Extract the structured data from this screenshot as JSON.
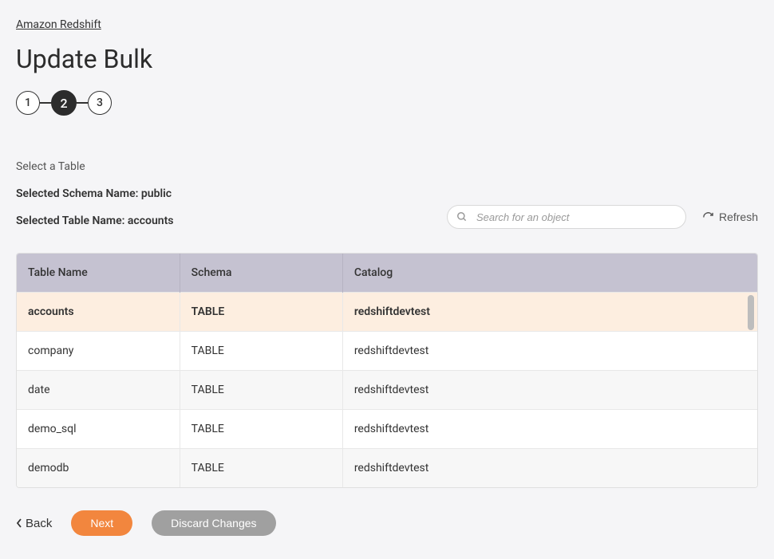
{
  "breadcrumb": {
    "label": "Amazon Redshift"
  },
  "page_title": "Update Bulk",
  "stepper": {
    "steps": [
      "1",
      "2",
      "3"
    ],
    "active_index": 1
  },
  "section_label": "Select a Table",
  "schema_info": "Selected Schema Name: public",
  "table_info": "Selected Table Name: accounts",
  "search": {
    "placeholder": "Search for an object"
  },
  "refresh_label": "Refresh",
  "table": {
    "headers": {
      "name": "Table Name",
      "schema": "Schema",
      "catalog": "Catalog"
    },
    "rows": [
      {
        "name": "accounts",
        "schema": "TABLE",
        "catalog": "redshiftdevtest",
        "selected": true
      },
      {
        "name": "company",
        "schema": "TABLE",
        "catalog": "redshiftdevtest",
        "selected": false
      },
      {
        "name": "date",
        "schema": "TABLE",
        "catalog": "redshiftdevtest",
        "selected": false
      },
      {
        "name": "demo_sql",
        "schema": "TABLE",
        "catalog": "redshiftdevtest",
        "selected": false
      },
      {
        "name": "demodb",
        "schema": "TABLE",
        "catalog": "redshiftdevtest",
        "selected": false
      }
    ]
  },
  "footer": {
    "back_label": "Back",
    "next_label": "Next",
    "discard_label": "Discard Changes"
  }
}
